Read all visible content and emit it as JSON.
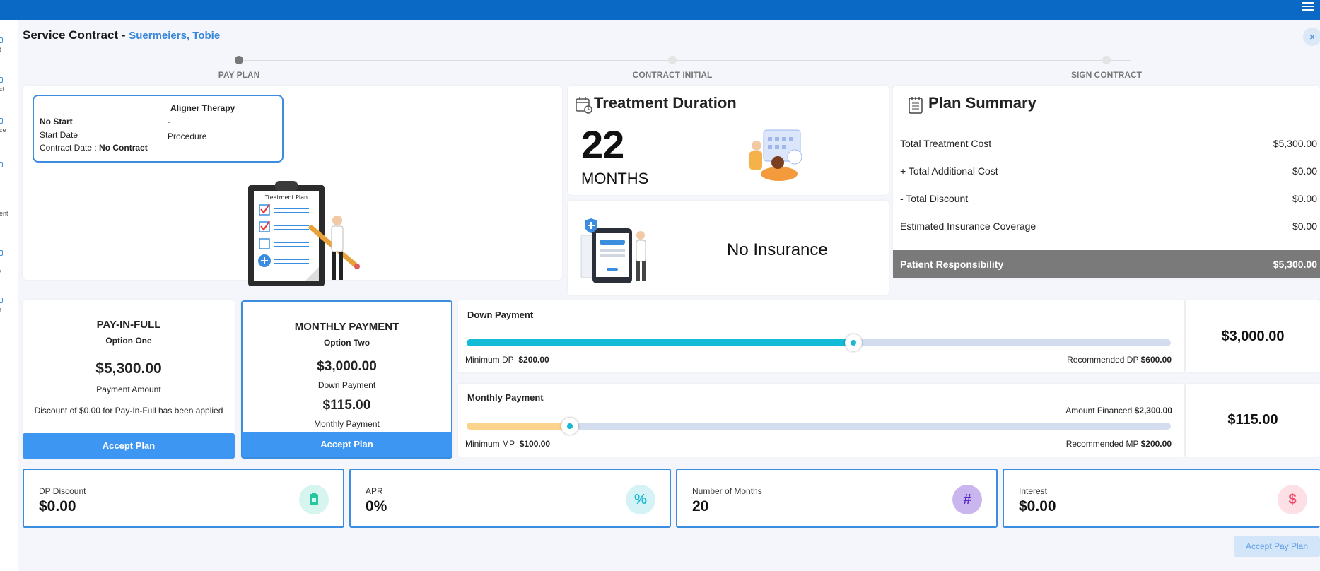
{
  "header": {
    "title": "Service Contract - ",
    "patient": "Suermeiers, Tobie",
    "close_symbol": "×"
  },
  "leftnav": {
    "items": [
      "nt",
      "act",
      "nce",
      "d",
      "nent",
      "t",
      "ry",
      "er"
    ]
  },
  "steps": [
    {
      "label": "PAY PLAN",
      "active": true
    },
    {
      "label": "CONTRACT INITIAL",
      "active": false
    },
    {
      "label": "SIGN CONTRACT",
      "active": false
    }
  ],
  "treatment_info": {
    "title": "Aligner Therapy",
    "start_status": "No Start",
    "start_date_label": "Start Date",
    "contract_date_label": "Contract Date : ",
    "contract_date_value": "No Contract",
    "dash": "-",
    "procedure_label": "Procedure",
    "illustration_text": "Treatment Plan"
  },
  "duration": {
    "title": "Treatment Duration",
    "months": "22",
    "unit": "MONTHS"
  },
  "insurance": {
    "status": "No Insurance"
  },
  "plan_summary": {
    "title": "Plan Summary",
    "rows": [
      {
        "label": "Total Treatment Cost",
        "value": "$5,300.00"
      },
      {
        "label": "+ Total Additional Cost",
        "value": "$0.00"
      },
      {
        "label": "- Total Discount",
        "value": "$0.00"
      },
      {
        "label": "Estimated Insurance Coverage",
        "value": "$0.00"
      }
    ],
    "total_label": "Patient Responsibility",
    "total_value": "$5,300.00"
  },
  "option_one": {
    "title": "PAY-IN-FULL",
    "subtitle": "Option One",
    "amount": "$5,300.00",
    "amount_label": "Payment Amount",
    "discount_note": "Discount of $0.00 for Pay-In-Full has been applied",
    "button": "Accept Plan"
  },
  "option_two": {
    "title": "MONTHLY PAYMENT",
    "subtitle": "Option Two",
    "down_payment": "$3,000.00",
    "down_payment_label": "Down Payment",
    "monthly": "$115.00",
    "monthly_label": "Monthly Payment",
    "button": "Accept Plan"
  },
  "down_payment_slider": {
    "title": "Down Payment",
    "position_fraction": 0.549,
    "fill_color": "#12bcd6",
    "min_label": "Minimum DP",
    "min_value": "$200.00",
    "rec_label": "Recommended DP",
    "rec_value": "$600.00",
    "value": "$3,000.00"
  },
  "monthly_slider": {
    "title": "Monthly Payment",
    "position_fraction": 0.147,
    "fill_color": "#fbd38d",
    "financed_label": "Amount Financed",
    "financed_value": "$2,300.00",
    "min_label": "Minimum MP",
    "min_value": "$100.00",
    "rec_label": "Recommended MP",
    "rec_value": "$200.00",
    "value": "$115.00"
  },
  "stats": [
    {
      "label": "DP Discount",
      "value": "$0.00",
      "icon": "clipboard-icon",
      "bg": "#d6f5ee",
      "color": "#26c7a0"
    },
    {
      "label": "APR",
      "value": "0%",
      "icon": "percent-icon",
      "symbol": "%",
      "bg": "#d5f3f7",
      "color": "#1cb9d2"
    },
    {
      "label": "Number of Months",
      "value": "20",
      "icon": "hash-icon",
      "symbol": "#",
      "bg": "#c9b6ef",
      "color": "#5b2fc2"
    },
    {
      "label": "Interest",
      "value": "$0.00",
      "icon": "dollar-icon",
      "symbol": "$",
      "bg": "#fde0e6",
      "color": "#f04b6a"
    }
  ],
  "footer": {
    "accept_pay_plan": "Accept Pay Plan"
  }
}
